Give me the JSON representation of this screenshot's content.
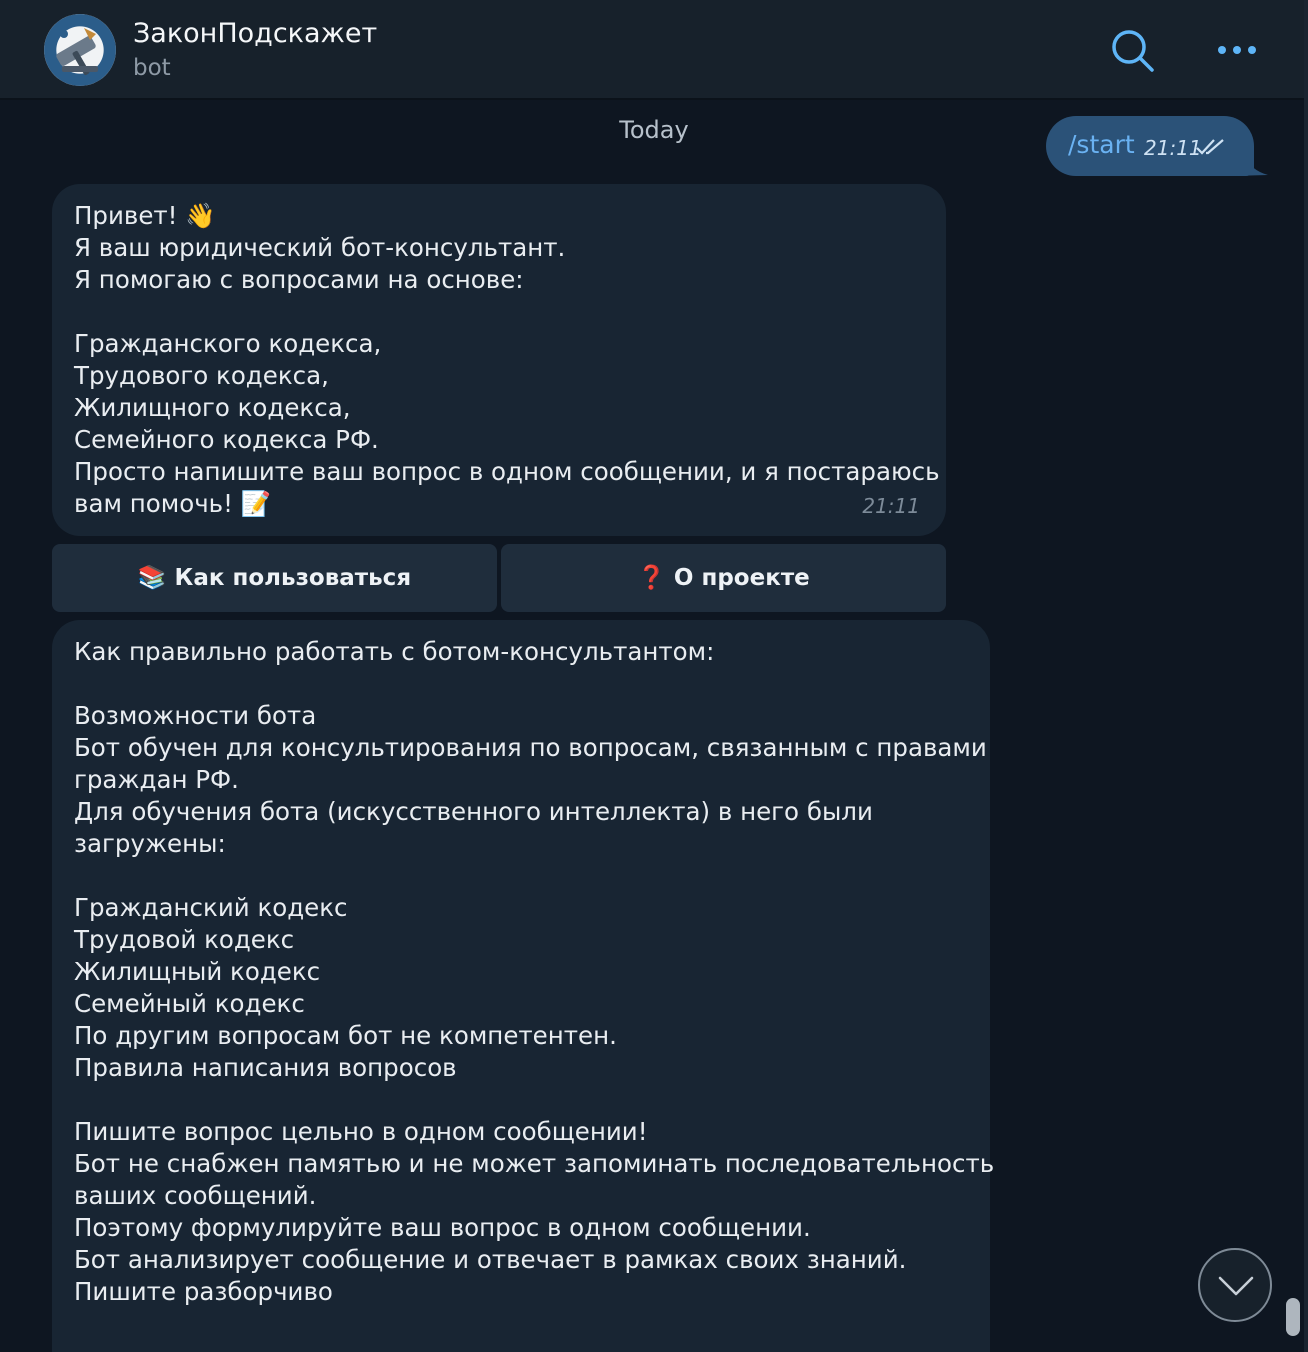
{
  "header": {
    "title": "ЗаконПодскажет",
    "subtitle": "bot",
    "search_icon": "search-icon",
    "more_icon": "more-dots-icon"
  },
  "chat": {
    "date_label": "Today",
    "outgoing": {
      "text": "/start",
      "time": "21:11",
      "status_icon": "double-check-icon"
    },
    "message1": {
      "lines": [
        "Привет! 👋",
        "Я ваш юридический бот-консультант.",
        "Я помогаю с вопросами на основе:",
        "",
        "Гражданского кодекса,",
        "Трудового кодекса,",
        "Жилищного кодекса,",
        "Семейного кодекса РФ.",
        "Просто напишите ваш вопрос в одном сообщении, и я постараюсь",
        "вам помочь! 📝"
      ],
      "time": "21:11"
    },
    "keyboard": {
      "howto_label": "📚 Как пользоваться",
      "about_label": "❓ О проекте"
    },
    "message2": {
      "lines": [
        "Как правильно работать с ботом-консультантом:",
        "",
        "Возможности бота",
        "Бот обучен для консультирования по вопросам, связанным с правами",
        "граждан РФ.",
        "Для обучения бота (искусственного интеллекта) в него были",
        "загружены:",
        "",
        "Гражданский кодекс",
        "Трудовой кодекс",
        "Жилищный кодекс",
        "Семейный кодекс",
        "По другим вопросам бот не компетентен.",
        "Правила написания вопросов",
        "",
        "Пишите вопрос цельно в одном сообщении!",
        "Бот не снабжен памятью и не может запоминать последовательность",
        "ваших сообщений.",
        "Поэтому формулируйте ваш вопрос в одном сообщении.",
        "Бот анализирует сообщение и отвечает в рамках своих знаний.",
        "Пишите разборчиво"
      ]
    },
    "scroll_down_icon": "chevron-down-icon"
  },
  "colors": {
    "background": "#0e1621",
    "header": "#17212b",
    "incoming_bubble": "#182533",
    "outgoing_bubble": "#2b5278",
    "accent": "#5eb5f7"
  }
}
